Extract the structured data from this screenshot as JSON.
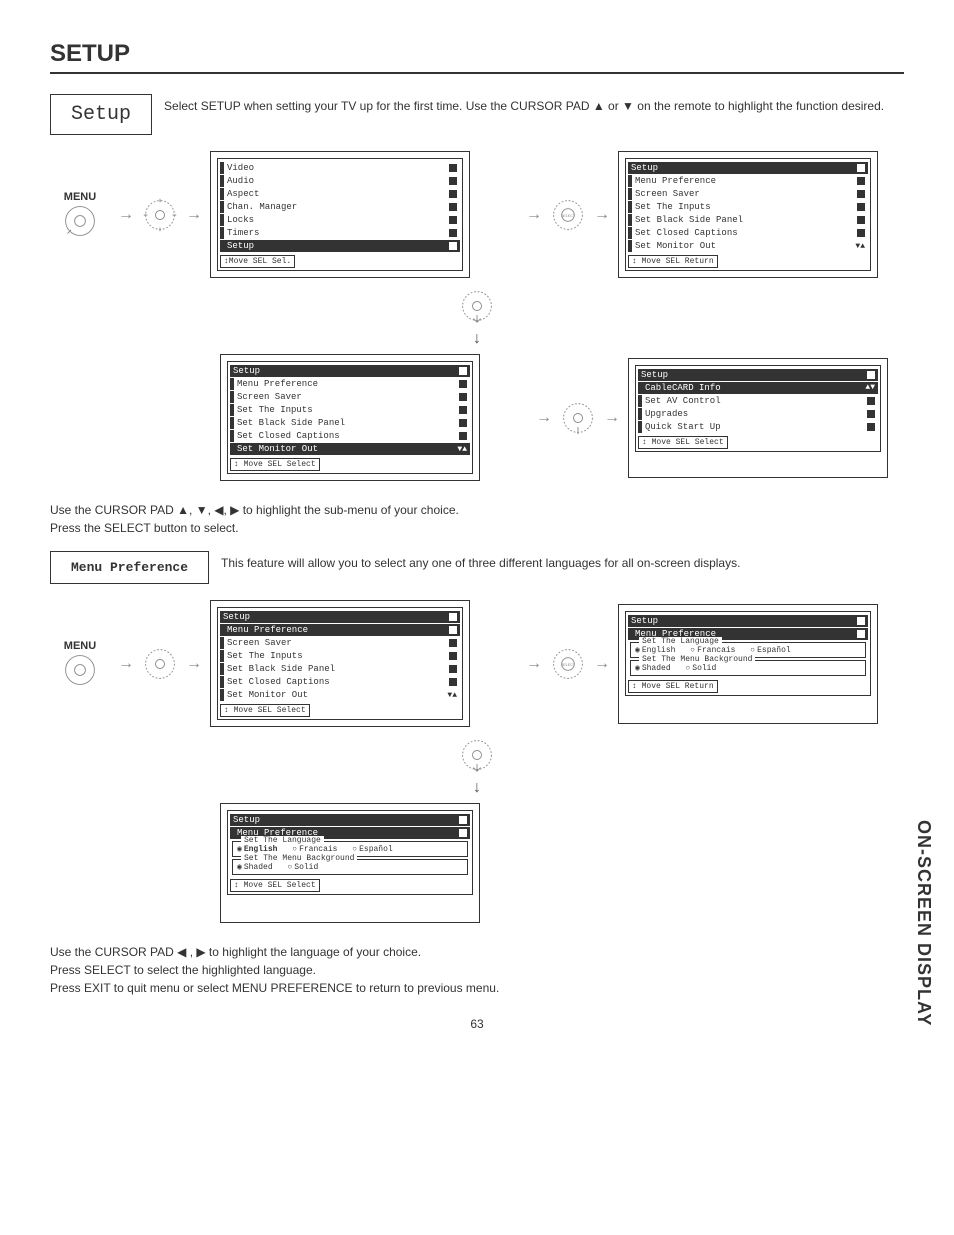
{
  "page": {
    "title": "SETUP",
    "sideLabel": "ON-SCREEN DISPLAY",
    "pageNumber": "63"
  },
  "setupHeading": {
    "boxTitle": "Setup",
    "intro": "Select SETUP when setting your TV up for the first time.  Use the CURSOR PAD ▲ or ▼ on the remote to highlight the function desired."
  },
  "labels": {
    "menu": "MENU",
    "select": "SELECT"
  },
  "osd": {
    "mainMenu": {
      "items": [
        "Video",
        "Audio",
        "Aspect",
        "Chan. Manager",
        "Locks",
        "Timers"
      ],
      "highlighted": "Setup",
      "footer": "↕Move  SEL Sel."
    },
    "setupMenu1": {
      "title": "Setup",
      "items": [
        "Menu Preference",
        "Screen Saver",
        "Set The Inputs",
        "Set Black Side Panel",
        "Set Closed Captions",
        "Set Monitor Out"
      ],
      "footer": "↕ Move  SEL Return"
    },
    "setupMenu2": {
      "title": "Setup",
      "items": [
        "Menu Preference",
        "Screen Saver",
        "Set The Inputs",
        "Set Black Side Panel",
        "Set Closed Captions"
      ],
      "highlighted": "Set Monitor Out",
      "footer": "↕ Move  SEL Select"
    },
    "setupMenu3": {
      "title": "Setup",
      "items": [
        "CableCARD Info",
        "Set AV Control",
        "Upgrades",
        "Quick Start Up"
      ],
      "footer": "↕ Move  SEL Select"
    },
    "setupMenuPref": {
      "title": "Setup",
      "highlighted": "Menu Preference",
      "items": [
        "Screen Saver",
        "Set The Inputs",
        "Set Black Side Panel",
        "Set Closed Captions",
        "Set Monitor Out"
      ],
      "footer": "↕ Move  SEL Select"
    },
    "prefDetail": {
      "title": "Setup",
      "sub": "Menu Preference",
      "langLabel": "Set The Language",
      "langs": [
        "English",
        "Francais",
        "Español"
      ],
      "bgLabel": "Set The Menu Background",
      "bgs": [
        "Shaded",
        "Solid"
      ],
      "footer1": "↕ Move  SEL Return",
      "footer2": "↕ Move  SEL Select"
    }
  },
  "midText1": "Use the CURSOR PAD ▲, ▼, ◀, ▶ to highlight the sub-menu of your choice.",
  "midText2": "Press the SELECT button to select.",
  "menuPref": {
    "boxTitle": "Menu Preference",
    "desc": "This feature will allow you to select any one of three different languages for all on-screen displays."
  },
  "bottomText1": "Use the CURSOR PAD ◀ , ▶ to highlight the language of your choice.",
  "bottomText2": "Press SELECT to select the highlighted language.",
  "bottomText3": "Press EXIT to quit menu or select MENU PREFERENCE to return to previous menu."
}
